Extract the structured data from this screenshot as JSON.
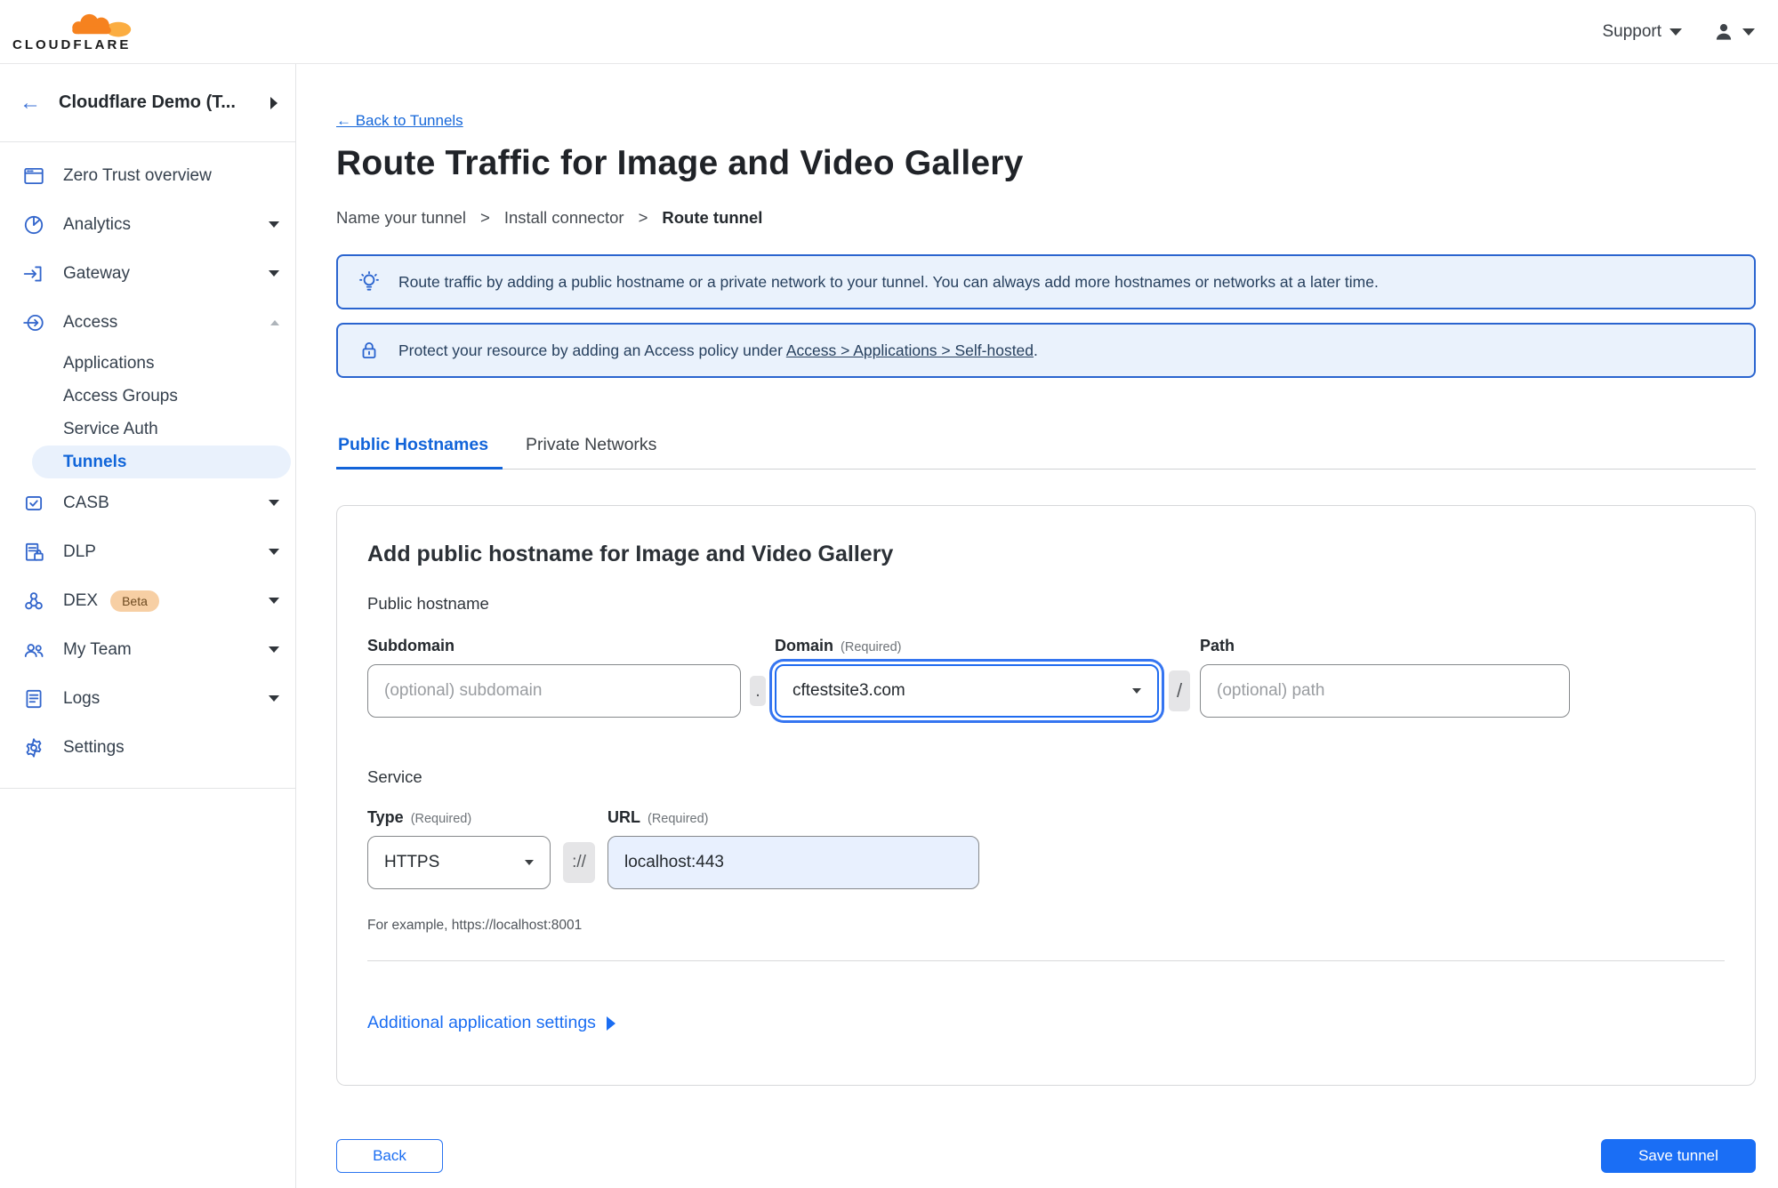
{
  "topbar": {
    "brand": "CLOUDFLARE",
    "support_label": "Support"
  },
  "sidebar": {
    "account": "Cloudflare Demo (T...",
    "items": [
      {
        "label": "Zero Trust overview",
        "icon": "overview-icon"
      },
      {
        "label": "Analytics",
        "icon": "analytics-icon",
        "chevron": "down"
      },
      {
        "label": "Gateway",
        "icon": "gateway-icon",
        "chevron": "down"
      },
      {
        "label": "Access",
        "icon": "access-icon",
        "chevron": "up",
        "expanded": true
      },
      {
        "label": "Applications",
        "sub": true
      },
      {
        "label": "Access Groups",
        "sub": true
      },
      {
        "label": "Service Auth",
        "sub": true
      },
      {
        "label": "Tunnels",
        "sub": true,
        "selected": true
      },
      {
        "label": "CASB",
        "icon": "casb-icon",
        "chevron": "down"
      },
      {
        "label": "DLP",
        "icon": "dlp-icon",
        "chevron": "down"
      },
      {
        "label": "DEX",
        "icon": "dex-icon",
        "badge": "Beta",
        "chevron": "down"
      },
      {
        "label": "My Team",
        "icon": "team-icon",
        "chevron": "down"
      },
      {
        "label": "Logs",
        "icon": "logs-icon",
        "chevron": "down"
      },
      {
        "label": "Settings",
        "icon": "settings-icon"
      }
    ]
  },
  "main": {
    "back_link": "← Back to Tunnels",
    "title": "Route Traffic for Image and Video Gallery",
    "steps": {
      "separator": ">",
      "items": [
        "Name your tunnel",
        "Install connector",
        "Route tunnel"
      ]
    },
    "banners": [
      {
        "icon": "lightbulb-icon",
        "text": "Route traffic by adding a public hostname or a private network to your tunnel. You can always add more hostnames or networks at a later time."
      },
      {
        "icon": "lock-icon",
        "text_prefix": "Protect your resource by adding an Access policy under ",
        "link": "Access > Applications > Self-hosted",
        "text_suffix": "."
      }
    ],
    "tabs": [
      {
        "label": "Public Hostnames",
        "active": true
      },
      {
        "label": "Private Networks",
        "active": false
      }
    ],
    "form": {
      "heading": "Add public hostname for Image and Video Gallery",
      "public_hostname_label": "Public hostname",
      "subdomain": {
        "label": "Subdomain",
        "placeholder": "(optional) subdomain",
        "value": ""
      },
      "dot_separator": ".",
      "domain": {
        "label": "Domain",
        "required": "(Required)",
        "value": "cftestsite3.com"
      },
      "slash_separator": "/",
      "path": {
        "label": "Path",
        "placeholder": "(optional) path",
        "value": ""
      },
      "service_label": "Service",
      "type": {
        "label": "Type",
        "required": "(Required)",
        "value": "HTTPS"
      },
      "scheme_separator": "://",
      "url": {
        "label": "URL",
        "required": "(Required)",
        "value": "localhost:443"
      },
      "hint": "For example, https://localhost:8001",
      "additional_settings_label": "Additional application settings"
    },
    "footer": {
      "back_label": "Back",
      "save_label": "Save tunnel"
    }
  },
  "colors": {
    "accent_blue": "#1a6ef5",
    "link_blue": "#1667d9",
    "banner_border": "#2a64cf",
    "banner_bg": "#eaf2fc",
    "selected_pill_bg": "#e9f1fc",
    "beta_badge_bg": "#f7cfa4",
    "logo_orange": "#f6821f",
    "logo_light_orange": "#fbad41",
    "url_autofill_bg": "#e8f0fe"
  }
}
